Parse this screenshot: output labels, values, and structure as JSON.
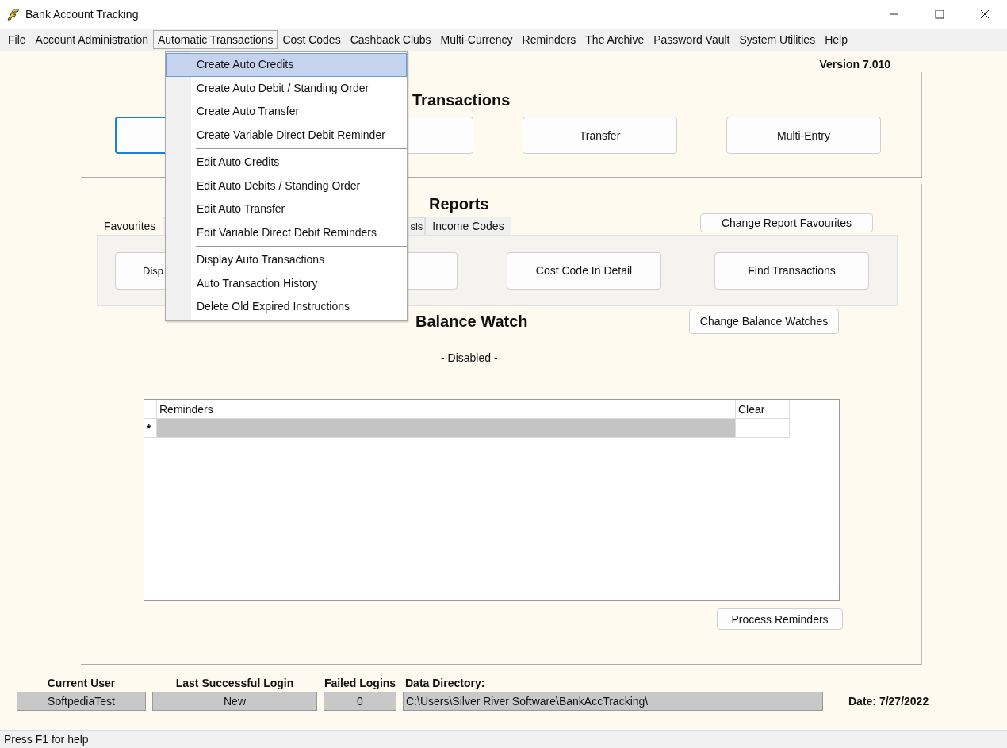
{
  "window": {
    "title": "Bank Account Tracking"
  },
  "menu_bar": [
    {
      "label": "File",
      "open": false
    },
    {
      "label": "Account Administration",
      "open": false
    },
    {
      "label": "Automatic Transactions",
      "open": true
    },
    {
      "label": "Cost Codes",
      "open": false
    },
    {
      "label": "Cashback Clubs",
      "open": false
    },
    {
      "label": "Multi-Currency",
      "open": false
    },
    {
      "label": "Reminders",
      "open": false
    },
    {
      "label": "The Archive",
      "open": false
    },
    {
      "label": "Password Vault",
      "open": false
    },
    {
      "label": "System Utilities",
      "open": false
    },
    {
      "label": "Help",
      "open": false
    }
  ],
  "dropdown": {
    "groups": [
      [
        {
          "label": "Create Auto Credits",
          "selected": true
        },
        {
          "label": "Create Auto Debit / Standing Order",
          "selected": false
        },
        {
          "label": "Create Auto Transfer",
          "selected": false
        },
        {
          "label": "Create Variable Direct Debit Reminder",
          "selected": false
        }
      ],
      [
        {
          "label": "Edit Auto Credits",
          "selected": false
        },
        {
          "label": "Edit Auto Debits / Standing Order",
          "selected": false
        },
        {
          "label": "Edit Auto Transfer",
          "selected": false
        },
        {
          "label": "Edit Variable Direct Debit Reminders",
          "selected": false
        }
      ],
      [
        {
          "label": "Display Auto Transactions",
          "selected": false
        },
        {
          "label": "Auto Transaction History",
          "selected": false
        },
        {
          "label": "Delete Old Expired Instructions",
          "selected": false
        }
      ]
    ]
  },
  "version": "Version 7.010",
  "transactions": {
    "heading": "Transactions",
    "buttons": [
      {
        "focused": true
      },
      {
        "focused": false
      },
      {
        "label": "Transfer",
        "focused": false
      },
      {
        "label": "Multi-Entry",
        "focused": false
      }
    ]
  },
  "reports": {
    "heading": "Reports",
    "tabs": [
      {
        "label": "Favourites",
        "selected": true
      },
      {
        "label": "sis",
        "selected": false
      },
      {
        "label": "Income Codes",
        "selected": false
      }
    ],
    "change_button": "Change Report Favourites",
    "buttons": [
      {
        "label": "Disp",
        "focused": false
      },
      {
        "focused": false
      },
      {
        "label": "Cost Code In Detail",
        "focused": false
      },
      {
        "label": "Find Transactions",
        "focused": false
      }
    ]
  },
  "balance_watch": {
    "heading": "Balance Watch",
    "change_button": "Change Balance Watches",
    "status": "- Disabled -"
  },
  "reminders": {
    "columns": [
      "Reminders",
      "Clear"
    ],
    "new_row_marker": "*",
    "process_button": "Process Reminders"
  },
  "login_info": [
    {
      "label": "Current User",
      "value": "SoftpediaTest"
    },
    {
      "label": "Last Successful Login",
      "value": "New"
    },
    {
      "label": "Failed Logins",
      "value": "0"
    },
    {
      "label": "Data Directory:",
      "value": "C:\\Users\\Silver River Software\\BankAccTracking\\"
    }
  ],
  "date": "Date: 7/27/2022",
  "status_bar": "Press F1 for help"
}
